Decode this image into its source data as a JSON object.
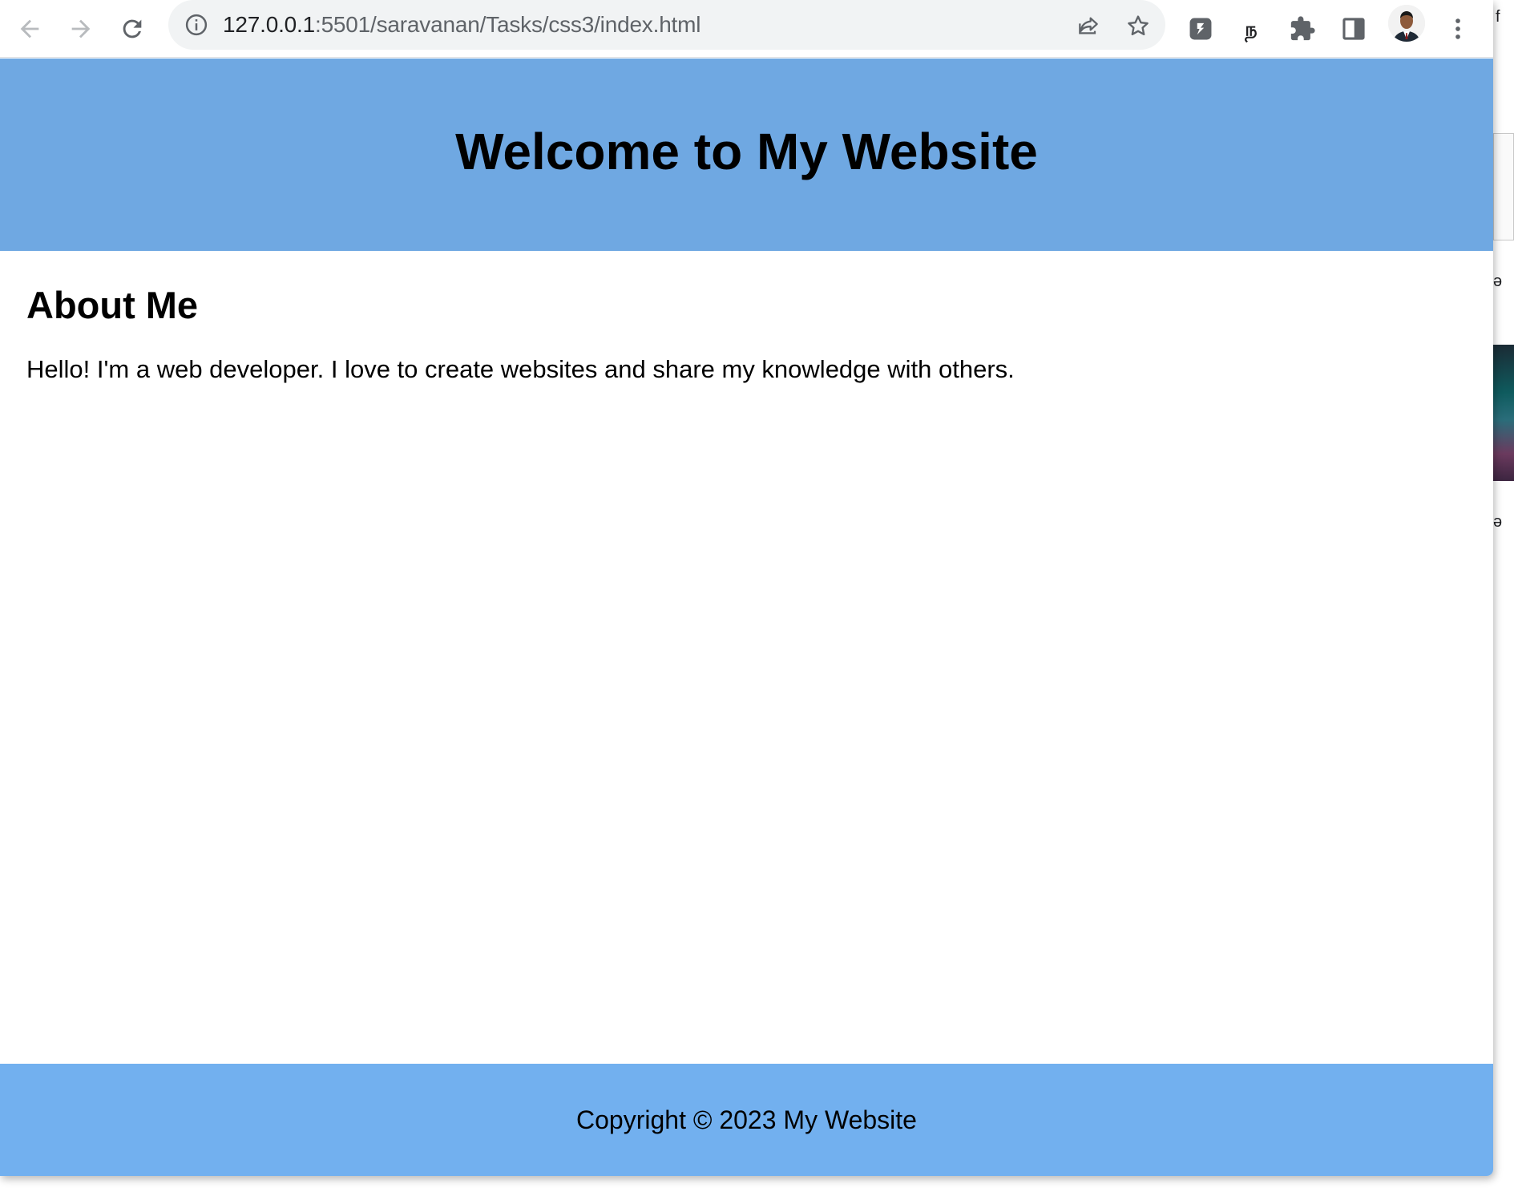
{
  "browser": {
    "url_host": "127.0.0.1",
    "url_rest": ":5501/saravanan/Tasks/css3/index.html",
    "icons": {
      "back": "arrow-left-icon",
      "forward": "arrow-right-icon",
      "reload": "reload-icon",
      "site_info": "info-icon",
      "share": "share-icon",
      "bookmark": "star-icon",
      "extension_1": "extension-badge-icon",
      "extension_2": "extension-script-icon",
      "extensions": "puzzle-icon",
      "side_panel": "side-panel-icon",
      "profile": "avatar-icon",
      "menu": "kebab-menu-icon"
    }
  },
  "page": {
    "header_title": "Welcome to My Website",
    "about_heading": "About Me",
    "about_text": "Hello! I'm a web developer. I love to create websites and share my knowledge with others.",
    "footer_text": "Copyright © 2023 My Website"
  },
  "background_window": {
    "glyphs": [
      "f",
      "ə",
      "ə"
    ]
  },
  "colors": {
    "header_bg": "#6fa8e2",
    "footer_bg": "#72b0ef",
    "toolbar_bg": "#ffffff",
    "omnibox_bg": "#f1f3f4"
  }
}
